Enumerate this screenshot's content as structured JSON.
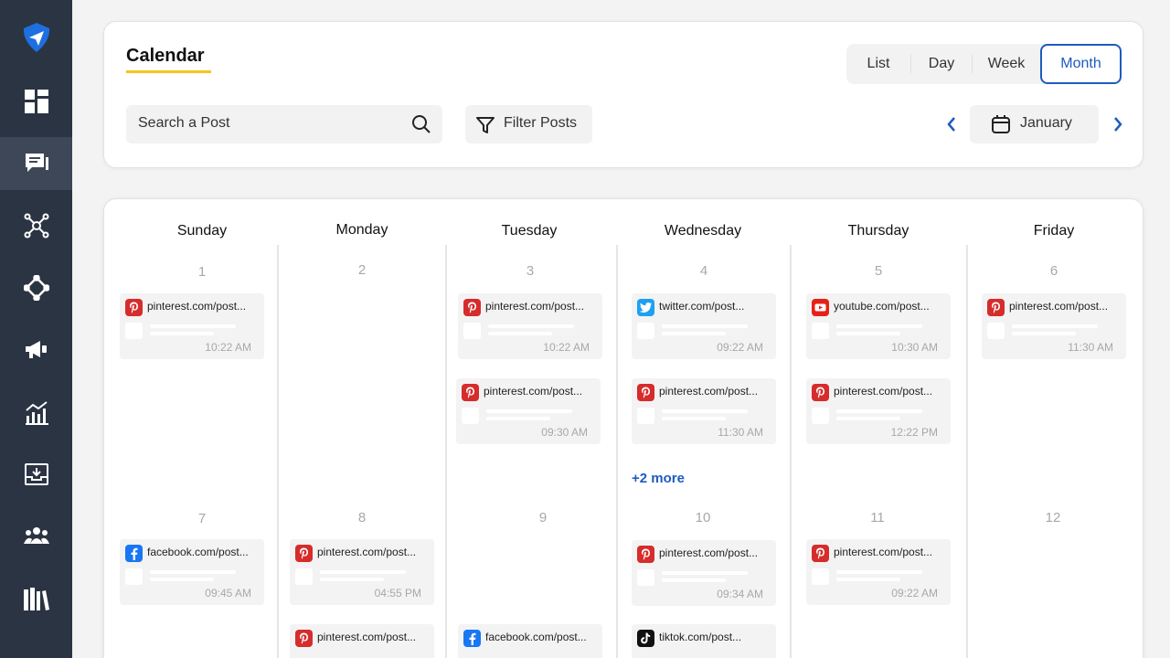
{
  "sidebar": {
    "items": [
      {
        "icon": "send-icon",
        "active": false
      },
      {
        "icon": "dashboard-icon",
        "active": false
      },
      {
        "icon": "posts-icon",
        "active": true
      },
      {
        "icon": "network-icon",
        "active": false
      },
      {
        "icon": "integrations-icon",
        "active": false
      },
      {
        "icon": "megaphone-icon",
        "active": false
      },
      {
        "icon": "analytics-icon",
        "active": false
      },
      {
        "icon": "inbox-icon",
        "active": false
      },
      {
        "icon": "team-icon",
        "active": false
      },
      {
        "icon": "library-icon",
        "active": false
      }
    ]
  },
  "header": {
    "title": "Calendar",
    "views": [
      "List",
      "Day",
      "Week",
      "Month"
    ],
    "active_view": "Month",
    "search_placeholder": "Search a Post",
    "filter_label": "Filter Posts",
    "month_label": "January"
  },
  "calendar": {
    "days": [
      "Sunday",
      "Monday",
      "Tuesday",
      "Wednesday",
      "Thursday",
      "Friday"
    ],
    "dates_row1": [
      "1",
      "2",
      "3",
      "4",
      "5",
      "6"
    ],
    "dates_row2": [
      "7",
      "8",
      "9",
      "10",
      "11",
      "12"
    ],
    "more_label": "+2 more",
    "posts": [
      {
        "platform": "pinterest",
        "url": "pinterest.com/post...",
        "time": "10:22 AM"
      },
      {
        "platform": "pinterest",
        "url": "pinterest.com/post...",
        "time": "10:22 AM"
      },
      {
        "platform": "pinterest",
        "url": "pinterest.com/post...",
        "time": "09:30 AM"
      },
      {
        "platform": "twitter",
        "url": "twitter.com/post...",
        "time": "09:22 AM"
      },
      {
        "platform": "pinterest",
        "url": "pinterest.com/post...",
        "time": "11:30 AM"
      },
      {
        "platform": "youtube",
        "url": "youtube.com/post...",
        "time": "10:30 AM"
      },
      {
        "platform": "pinterest",
        "url": "pinterest.com/post...",
        "time": "12:22 PM"
      },
      {
        "platform": "pinterest",
        "url": "pinterest.com/post...",
        "time": "11:30 AM"
      },
      {
        "platform": "facebook",
        "url": "facebook.com/post...",
        "time": "09:45 AM"
      },
      {
        "platform": "pinterest",
        "url": "pinterest.com/post...",
        "time": "04:55 PM"
      },
      {
        "platform": "pinterest",
        "url": "pinterest.com/post...",
        "time": "09:34 AM"
      },
      {
        "platform": "pinterest",
        "url": "pinterest.com/post...",
        "time": "09:22 AM"
      },
      {
        "platform": "pinterest",
        "url": "pinterest.com/post...",
        "time": ""
      },
      {
        "platform": "facebook",
        "url": "facebook.com/post...",
        "time": ""
      },
      {
        "platform": "tiktok",
        "url": "tiktok.com/post...",
        "time": ""
      }
    ]
  },
  "colors": {
    "sidebar": "#2b3443",
    "accent": "#1e5bbf",
    "underline": "#f5c518",
    "pinterest": "#d62c2c",
    "twitter": "#1da1f2",
    "youtube": "#e62117",
    "facebook": "#1877f2",
    "tiktok": "#111111"
  }
}
